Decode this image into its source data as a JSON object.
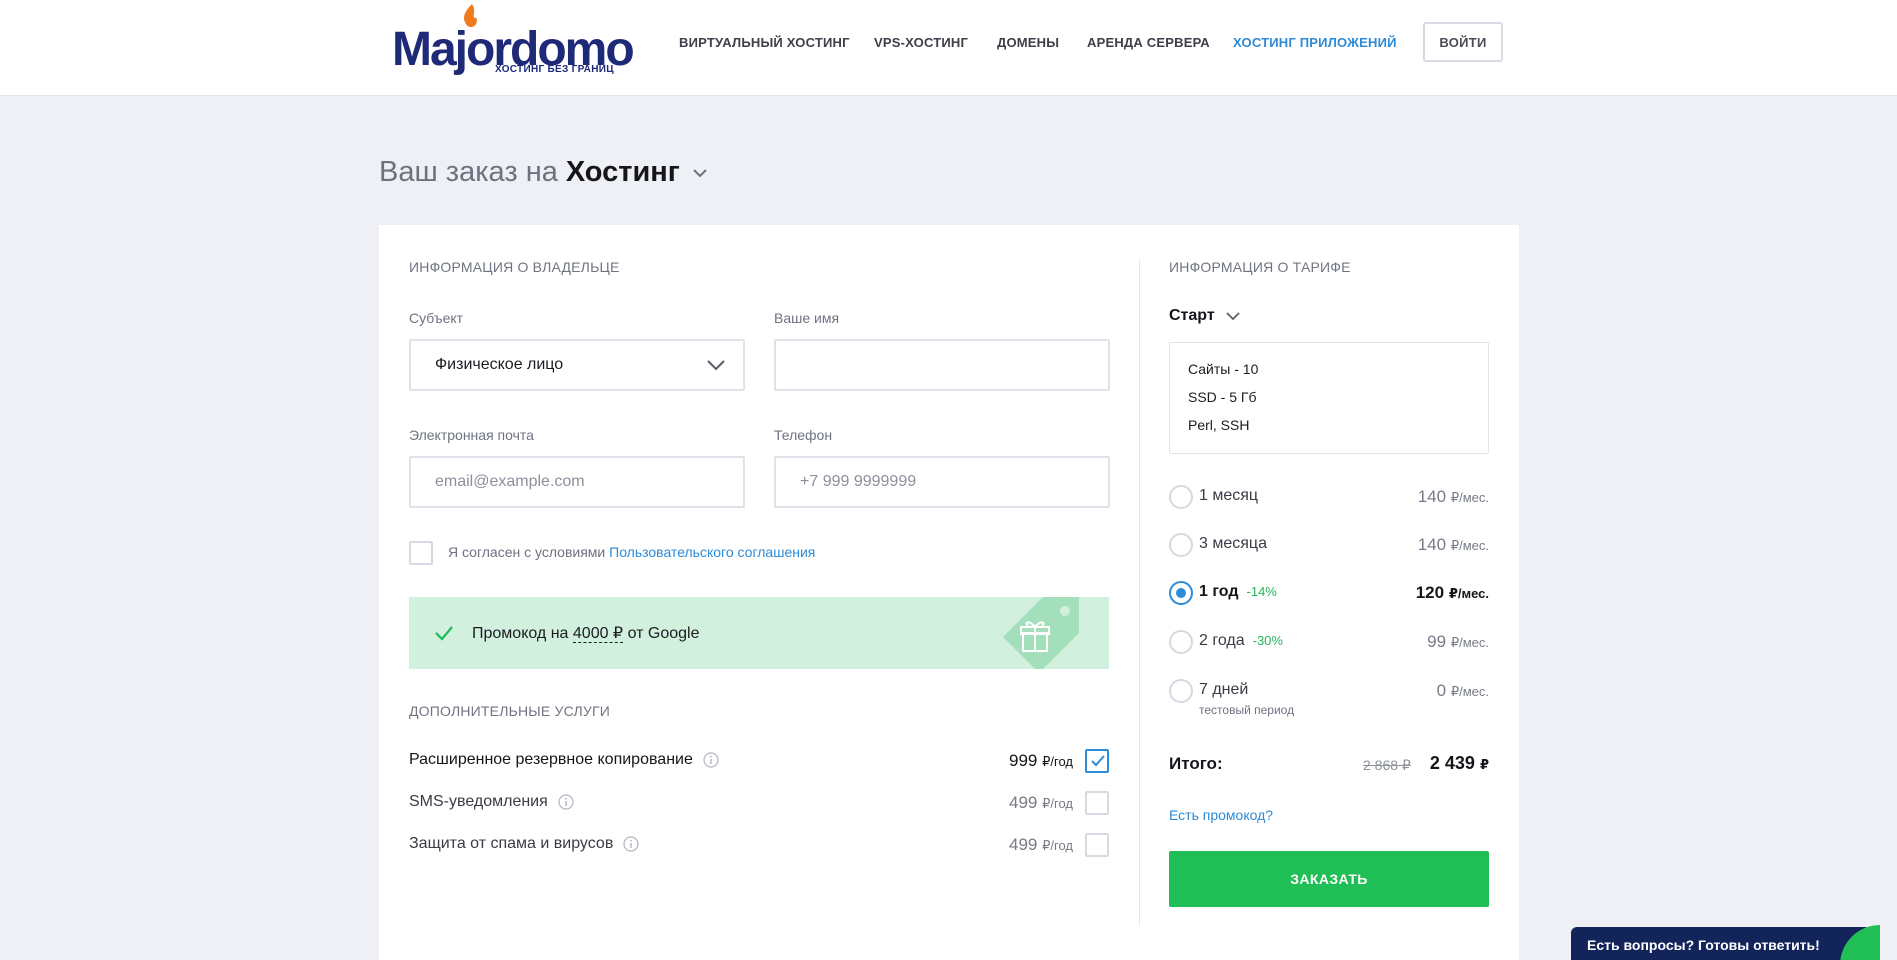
{
  "header": {
    "logo_text": "Majordomo",
    "logo_tagline": "ХОСТИНГ БЕЗ ГРАНИЦ",
    "nav": [
      {
        "label": "ВИРТУАЛЬНЫЙ ХОСТИНГ",
        "active": false
      },
      {
        "label": "VPS-ХОСТИНГ",
        "active": false
      },
      {
        "label": "ДОМЕНЫ",
        "active": false
      },
      {
        "label": "АРЕНДА СЕРВЕРА",
        "active": false
      },
      {
        "label": "ХОСТИНГ ПРИЛОЖЕНИЙ",
        "active": true
      }
    ],
    "login_label": "ВОЙТИ"
  },
  "page": {
    "title_prefix": "Ваш заказ на",
    "title_product": "Хостинг"
  },
  "owner": {
    "section_label": "ИНФОРМАЦИЯ О ВЛАДЕЛЬЦЕ",
    "subject_label": "Субъект",
    "subject_value": "Физическое лицо",
    "name_label": "Ваше имя",
    "name_value": "",
    "email_label": "Электронная почта",
    "email_placeholder": "email@example.com",
    "phone_label": "Телефон",
    "phone_placeholder": "+7 999 9999999",
    "agree_text": "Я согласен с условиями",
    "agree_link": "Пользовательского соглашения"
  },
  "promo": {
    "text_before": "Промокод на",
    "amount": "4000 ₽",
    "text_after": "от Google"
  },
  "services": {
    "section_label": "ДОПОЛНИТЕЛЬНЫЕ УСЛУГИ",
    "items": [
      {
        "name": "Расширенное резервное копирование",
        "price": "999",
        "unit": "₽/год",
        "checked": true
      },
      {
        "name": "SMS-уведомления",
        "price": "499",
        "unit": "₽/год",
        "checked": false
      },
      {
        "name": "Защита от спама и вирусов",
        "price": "499",
        "unit": "₽/год",
        "checked": false
      }
    ]
  },
  "tariff": {
    "section_label": "ИНФОРМАЦИЯ О ТАРИФЕ",
    "name": "Старт",
    "features": [
      "Сайты - 10",
      "SSD - 5 Гб",
      "Perl, SSH"
    ],
    "periods": [
      {
        "label": "1 месяц",
        "discount": "",
        "sub": "",
        "price": "140",
        "unit": "₽/мес.",
        "selected": false
      },
      {
        "label": "3 месяца",
        "discount": "",
        "sub": "",
        "price": "140",
        "unit": "₽/мес.",
        "selected": false
      },
      {
        "label": "1 год",
        "discount": "-14%",
        "sub": "",
        "price": "120",
        "unit": "₽/мес.",
        "selected": true
      },
      {
        "label": "2 года",
        "discount": "-30%",
        "sub": "",
        "price": "99",
        "unit": "₽/мес.",
        "selected": false
      },
      {
        "label": "7 дней",
        "discount": "",
        "sub": "тестовый период",
        "price": "0",
        "unit": "₽/мес.",
        "selected": false
      }
    ],
    "total_label": "Итого:",
    "total_old": "2 868 ₽",
    "total_new": "2 439",
    "total_unit": "₽",
    "promo_link": "Есть промокод?",
    "order_label": "ЗАКАЗАТЬ"
  },
  "chat": {
    "label": "Есть вопросы? Готовы ответить!"
  },
  "colors": {
    "accent_blue": "#2d8bd8",
    "green": "#20bf56",
    "promo_bg": "#d2f0de",
    "page_bg": "#eff0f5",
    "brand_navy": "#1e2a78"
  }
}
